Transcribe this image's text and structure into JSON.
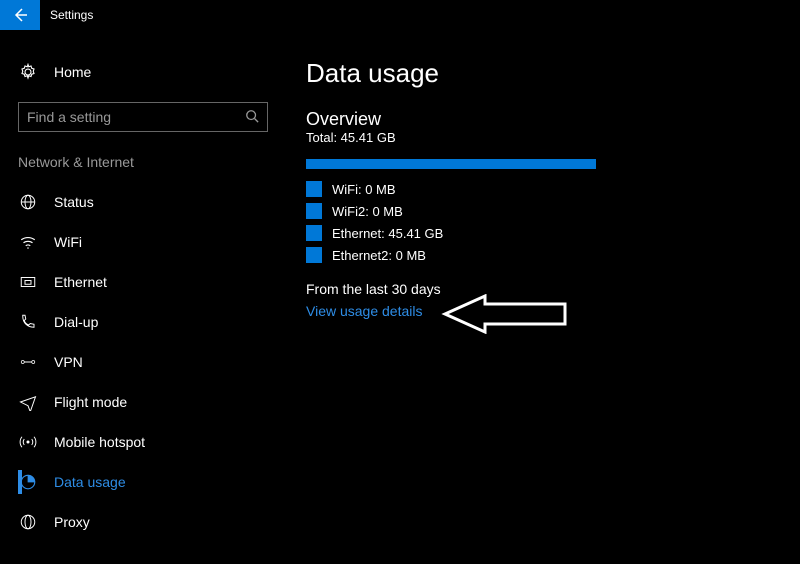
{
  "window": {
    "title": "Settings"
  },
  "sidebar": {
    "home": "Home",
    "search_placeholder": "Find a setting",
    "section": "Network & Internet",
    "items": [
      {
        "label": "Status"
      },
      {
        "label": "WiFi"
      },
      {
        "label": "Ethernet"
      },
      {
        "label": "Dial-up"
      },
      {
        "label": "VPN"
      },
      {
        "label": "Flight mode"
      },
      {
        "label": "Mobile hotspot"
      },
      {
        "label": "Data usage"
      },
      {
        "label": "Proxy"
      }
    ]
  },
  "main": {
    "title": "Data usage",
    "overview_heading": "Overview",
    "total": "Total: 45.41 GB",
    "legend": [
      {
        "label": "WiFi: 0 MB"
      },
      {
        "label": "WiFi2: 0 MB"
      },
      {
        "label": "Ethernet: 45.41 GB"
      },
      {
        "label": "Ethernet2: 0 MB"
      }
    ],
    "period": "From the last 30 days",
    "link": "View usage details"
  },
  "colors": {
    "accent": "#0078d7",
    "link": "#2e8de6"
  }
}
